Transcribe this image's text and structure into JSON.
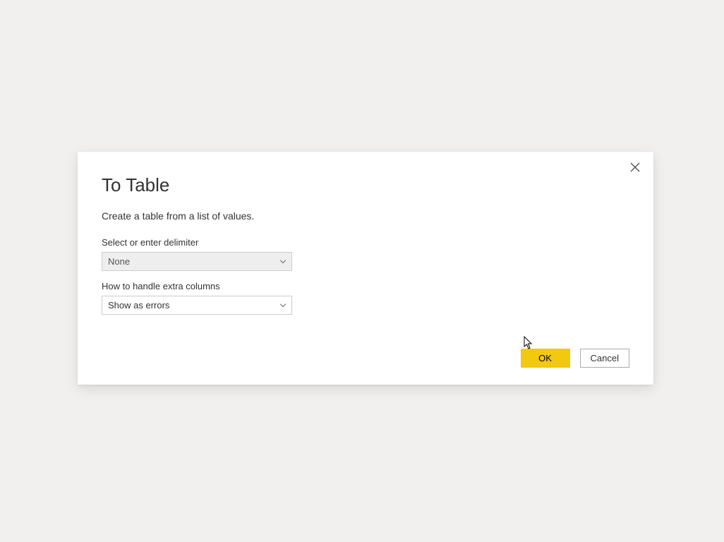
{
  "dialog": {
    "title": "To Table",
    "subtitle": "Create a table from a list of values.",
    "fields": {
      "delimiter": {
        "label": "Select or enter delimiter",
        "value": "None"
      },
      "extraColumns": {
        "label": "How to handle extra columns",
        "value": "Show as errors"
      }
    },
    "buttons": {
      "ok": "OK",
      "cancel": "Cancel"
    }
  }
}
